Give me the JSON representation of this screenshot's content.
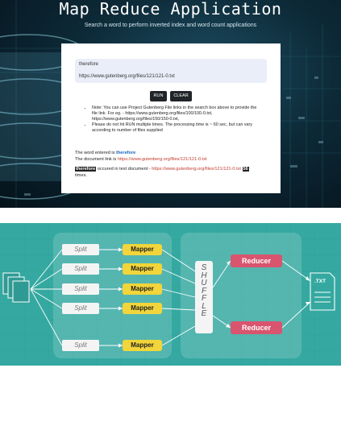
{
  "hero": {
    "title": "Map Reduce Application",
    "subtitle": "Search a word to perform inverted index and word count applications",
    "search": {
      "word_value": "therefore",
      "url_value": "https://www.gutenberg.org/files/121/121-0.txt"
    },
    "buttons": {
      "run": "RUN",
      "clear": "CLEAR"
    },
    "notes": [
      "Note: You can use Project Gutenberg File links in the search box above to provide the file link. For eg. - https://www.gutenberg.org/files/100/100-0.txt, https://www.gutenberg.org/files/150/150-0.txt,",
      "Please do not hit RUN multiple times. The processing time is ~ 60 sec, but can vary according to number of files supplied"
    ],
    "result": {
      "word_prefix": "The word entered is ",
      "word": "therefore",
      "doc_prefix": "The document link is ",
      "doc_link": "https://www.gutenberg.org/files/121/121-0.txt",
      "occ_word": "therefore",
      "occ_mid": " occured in text document - ",
      "occ_link": "https://www.gutenberg.org/files/121/121-0.txt",
      "occ_count": "56",
      "occ_suffix": "times."
    }
  },
  "diagram": {
    "splits": [
      "Split",
      "Split",
      "Split",
      "Split",
      "Split"
    ],
    "mappers": [
      "Mapper",
      "Mapper",
      "Mapper",
      "Mapper",
      "Mapper"
    ],
    "shuffle_letters": [
      "S",
      "H",
      "U",
      "F",
      "F",
      "L",
      "E"
    ],
    "reducers": [
      "Reducer",
      "Reducer"
    ],
    "output_label": ".TXT",
    "colors": {
      "background": "#35a9a1",
      "mapper": "#f1d53a",
      "reducer": "#d9546e",
      "split": "#f4f4f4"
    }
  }
}
